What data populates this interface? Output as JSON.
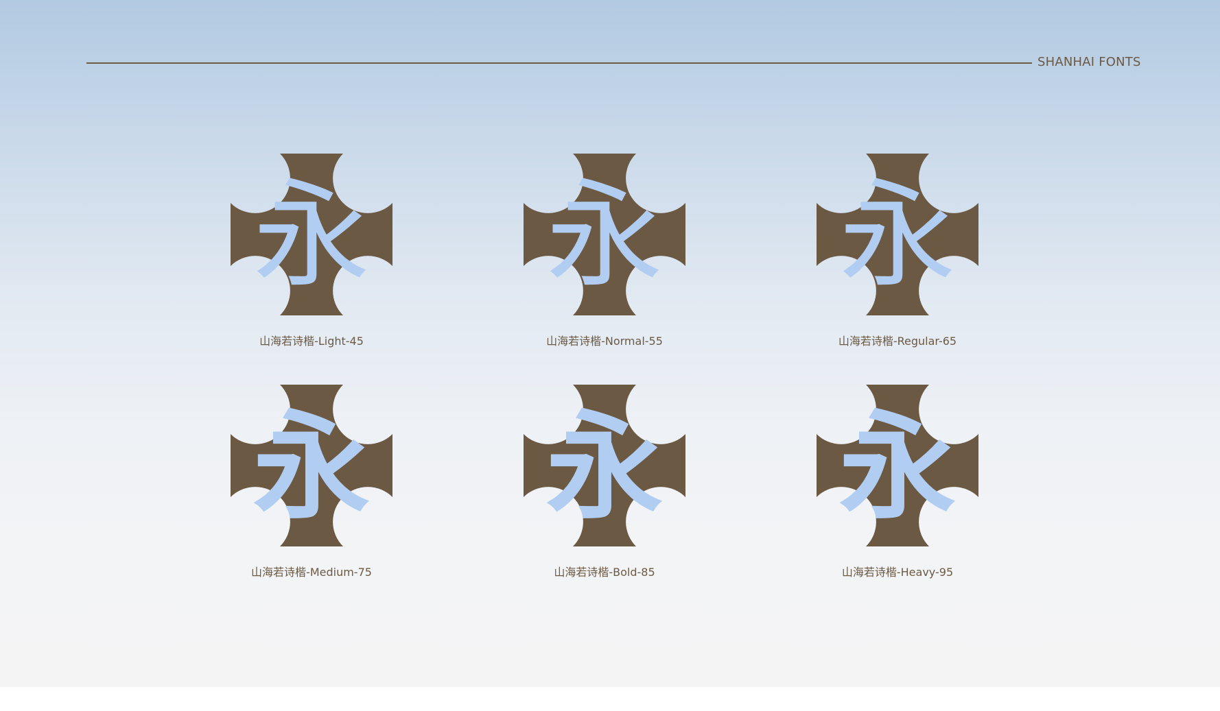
{
  "brand": "SHANHAI FONTS",
  "glyph_char": "永",
  "colors": {
    "badge_fill": "#6b5943",
    "glyph": "#b1cdf2",
    "text": "#6b5943",
    "bg_top": "#b2cae2",
    "bg_bottom": "#f4f4f5"
  },
  "badges": [
    {
      "label": "山海若诗楷-Light-45",
      "weight": 300
    },
    {
      "label": "山海若诗楷-Normal-55",
      "weight": 400
    },
    {
      "label": "山海若诗楷-Regular-65",
      "weight": 500
    },
    {
      "label": "山海若诗楷-Medium-75",
      "weight": 600
    },
    {
      "label": "山海若诗楷-Bold-85",
      "weight": 700
    },
    {
      "label": "山海若诗楷-Heavy-95",
      "weight": 900
    }
  ]
}
